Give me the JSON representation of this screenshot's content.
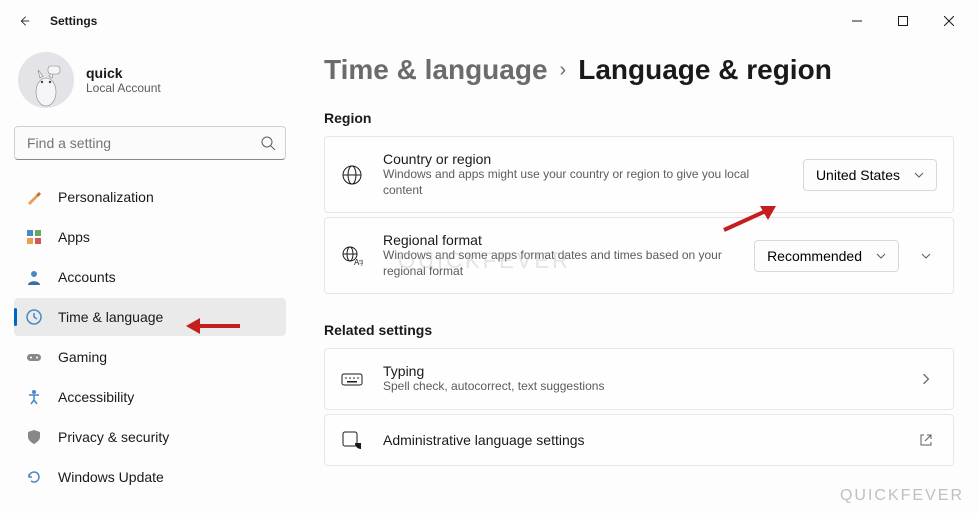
{
  "window": {
    "title": "Settings"
  },
  "profile": {
    "name": "quick",
    "subtitle": "Local Account"
  },
  "search": {
    "placeholder": "Find a setting"
  },
  "sidebar": {
    "items": [
      {
        "label": "Personalization"
      },
      {
        "label": "Apps"
      },
      {
        "label": "Accounts"
      },
      {
        "label": "Time & language"
      },
      {
        "label": "Gaming"
      },
      {
        "label": "Accessibility"
      },
      {
        "label": "Privacy & security"
      },
      {
        "label": "Windows Update"
      }
    ],
    "activeIndex": 3
  },
  "breadcrumb": {
    "parent": "Time & language",
    "current": "Language & region"
  },
  "sections": {
    "region": {
      "title": "Region",
      "country": {
        "title": "Country or region",
        "sub": "Windows and apps might use your country or region to give you local content",
        "value": "United States"
      },
      "format": {
        "title": "Regional format",
        "sub": "Windows and some apps format dates and times based on your regional format",
        "value": "Recommended"
      }
    },
    "related": {
      "title": "Related settings",
      "typing": {
        "title": "Typing",
        "sub": "Spell check, autocorrect, text suggestions"
      },
      "admin": {
        "title": "Administrative language settings"
      }
    }
  },
  "watermark": "QUICKFEVER"
}
